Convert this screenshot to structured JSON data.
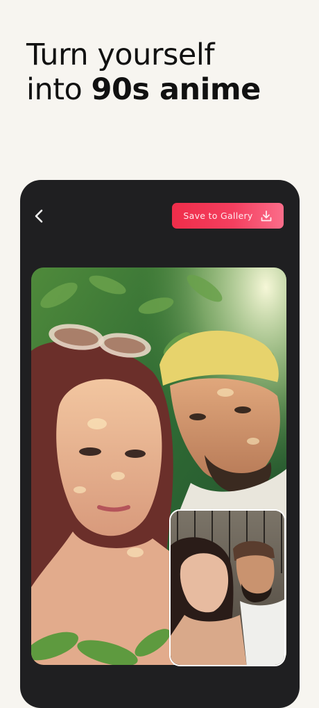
{
  "headline": {
    "line1": "Turn yourself",
    "line2_prefix": "into ",
    "line2_bold": "90s anime"
  },
  "toolbar": {
    "back_icon": "chevron-left-icon",
    "save_label": "Save to Gallery",
    "save_icon": "download-icon"
  },
  "colors": {
    "background": "#f7f5f0",
    "panel": "#1f1f21",
    "accent": "#ef2d4a"
  }
}
